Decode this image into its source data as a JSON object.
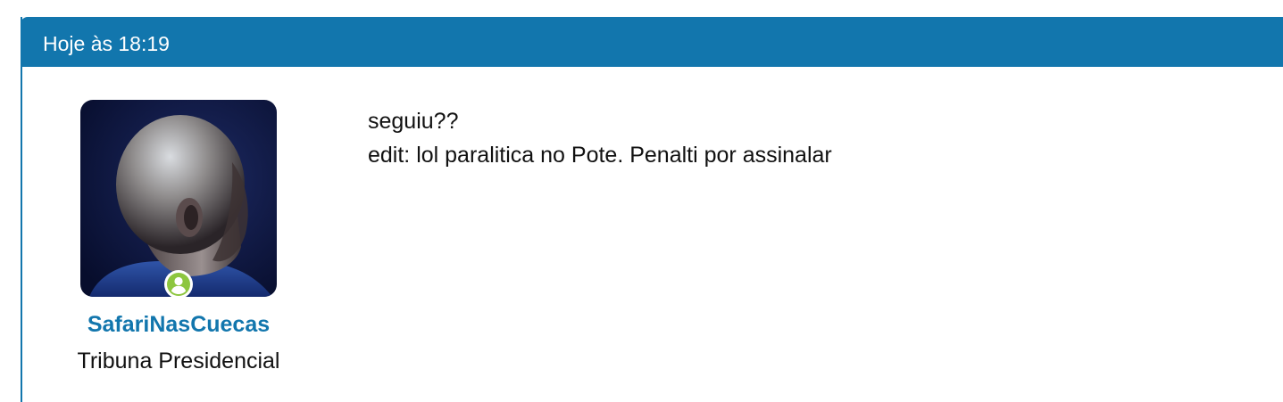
{
  "post": {
    "timestamp": "Hoje às 18:19",
    "author": {
      "username": "SafariNasCuecas",
      "rank": "Tribuna Presidencial",
      "online_status": "online",
      "online_icon": "user-circle-icon"
    },
    "message": {
      "lines": [
        "seguiu??",
        "edit: lol paralitica no Pote. Penalti por assinalar"
      ]
    }
  },
  "colors": {
    "accent": "#1276ad",
    "online": "#8dc63f",
    "text": "#111111",
    "avatar_background": "#0b1640"
  }
}
